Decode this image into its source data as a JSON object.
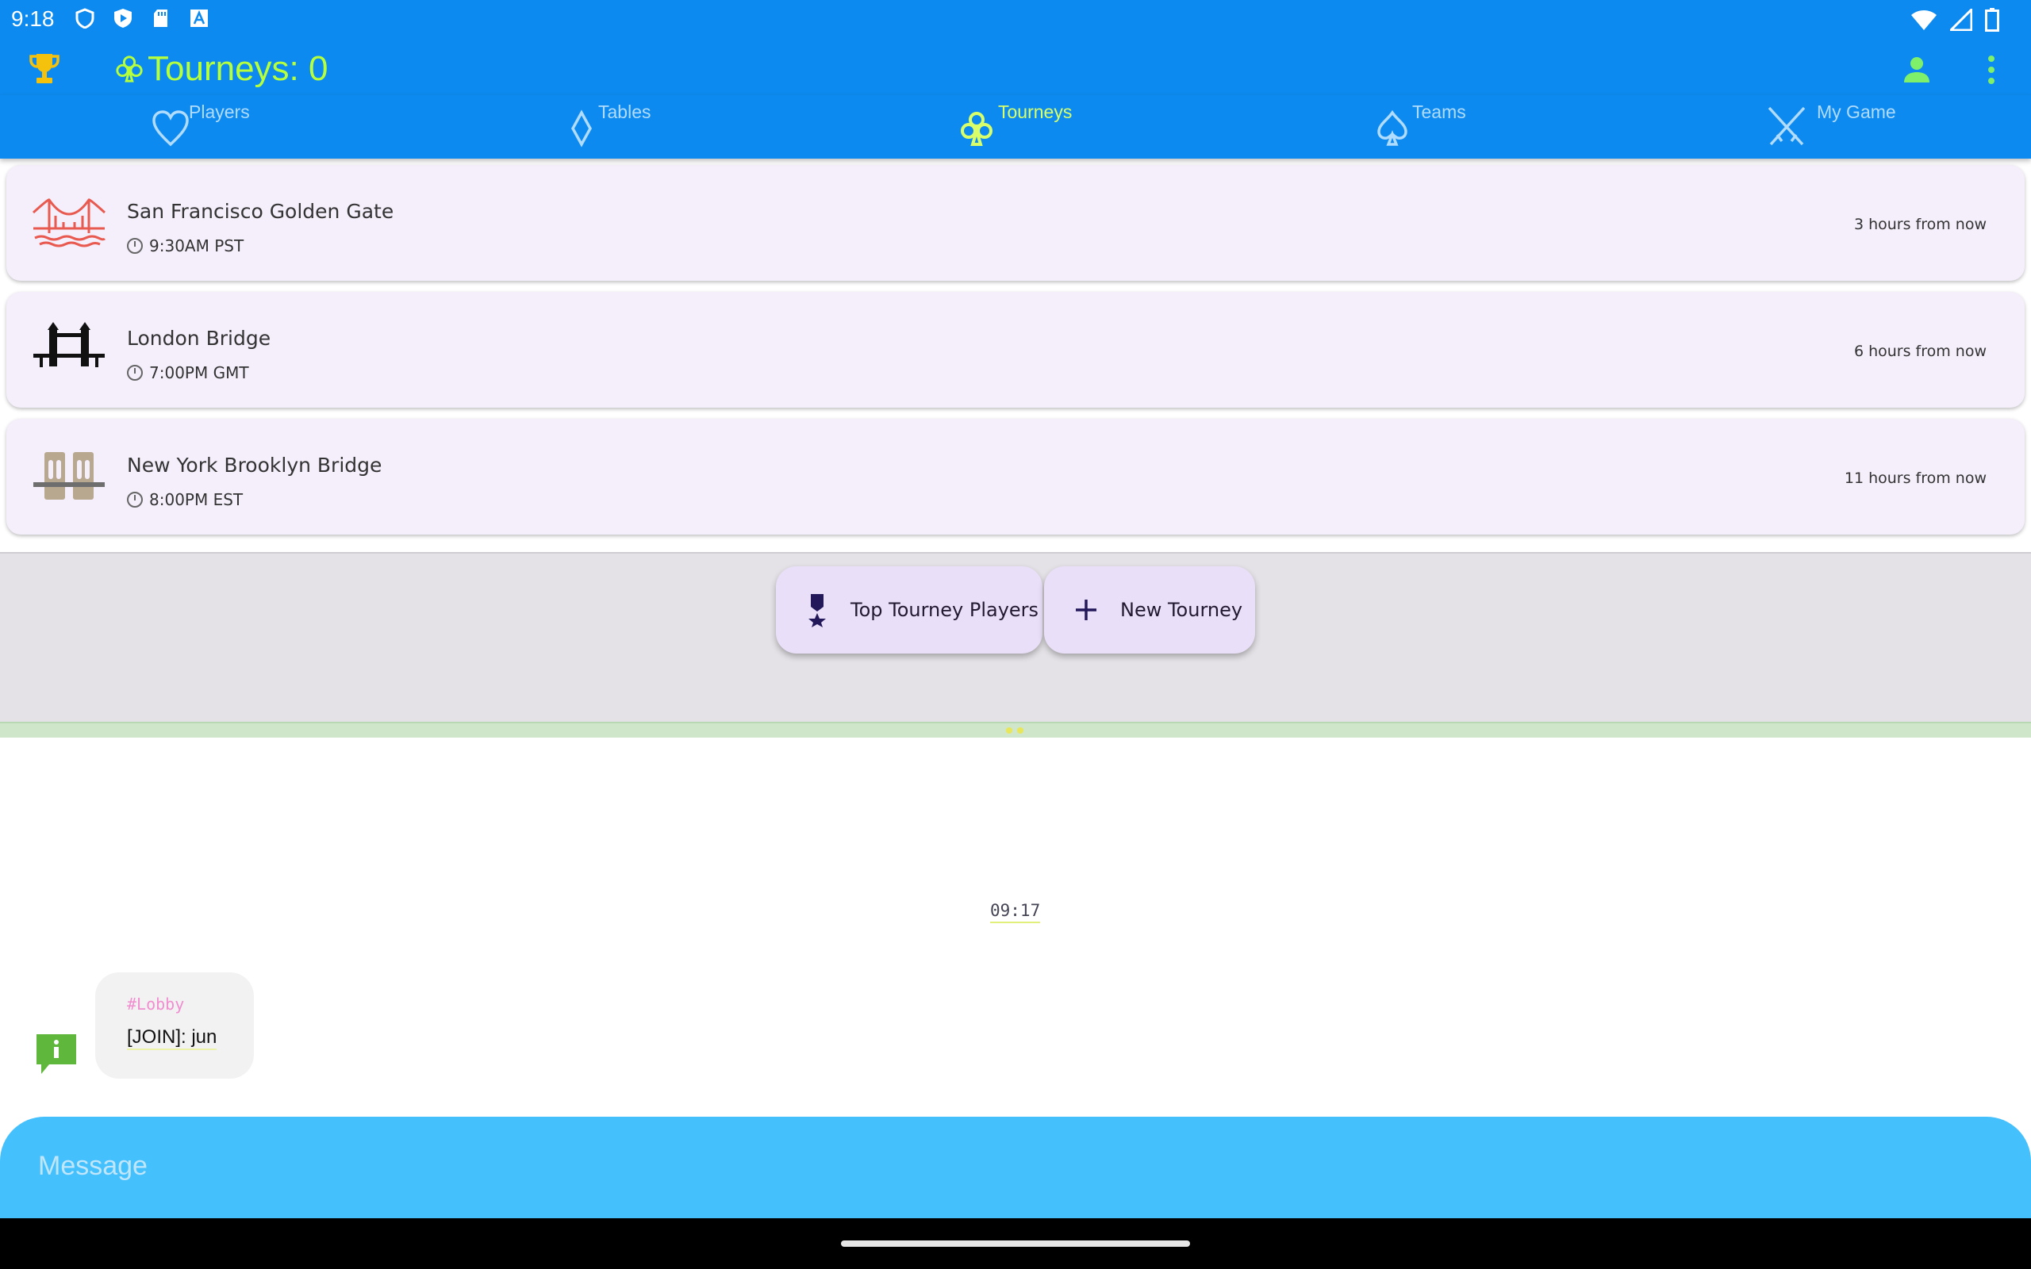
{
  "status_bar": {
    "time": "9:18",
    "left_icons": [
      "shield-icon",
      "play-protect-icon",
      "sd-card-icon",
      "font-icon"
    ],
    "right_icons": [
      "wifi-icon",
      "signal-icon",
      "battery-icon"
    ]
  },
  "app_bar": {
    "title": "Tourneys: 0",
    "title_color": "#b6ff3c",
    "background": "#0d8aef"
  },
  "tabs": [
    {
      "label": "Players",
      "icon": "heart-icon",
      "active": false
    },
    {
      "label": "Tables",
      "icon": "diamond-icon",
      "active": false
    },
    {
      "label": "Tourneys",
      "icon": "club-icon",
      "active": true
    },
    {
      "label": "Teams",
      "icon": "spade-icon",
      "active": false
    },
    {
      "label": "My Game",
      "icon": "crossed-swords-icon",
      "active": false
    }
  ],
  "tourneys": [
    {
      "name": "San Francisco Golden Gate",
      "time": "9:30AM PST",
      "relative": "3 hours from now",
      "icon": "golden-gate-bridge-icon"
    },
    {
      "name": "London Bridge",
      "time": "7:00PM GMT",
      "relative": "6 hours from now",
      "icon": "tower-bridge-icon"
    },
    {
      "name": "New York Brooklyn Bridge",
      "time": "8:00PM EST",
      "relative": "11 hours from now",
      "icon": "brooklyn-bridge-icon"
    }
  ],
  "actions": {
    "top_players_label": "Top Tourney Players",
    "new_tourney_label": "New Tourney"
  },
  "chat": {
    "timestamp": "09:17",
    "messages": [
      {
        "channel": "#Lobby",
        "text": "[JOIN]: jun",
        "icon": "info-chat-icon"
      }
    ],
    "composer_placeholder": "Message"
  }
}
